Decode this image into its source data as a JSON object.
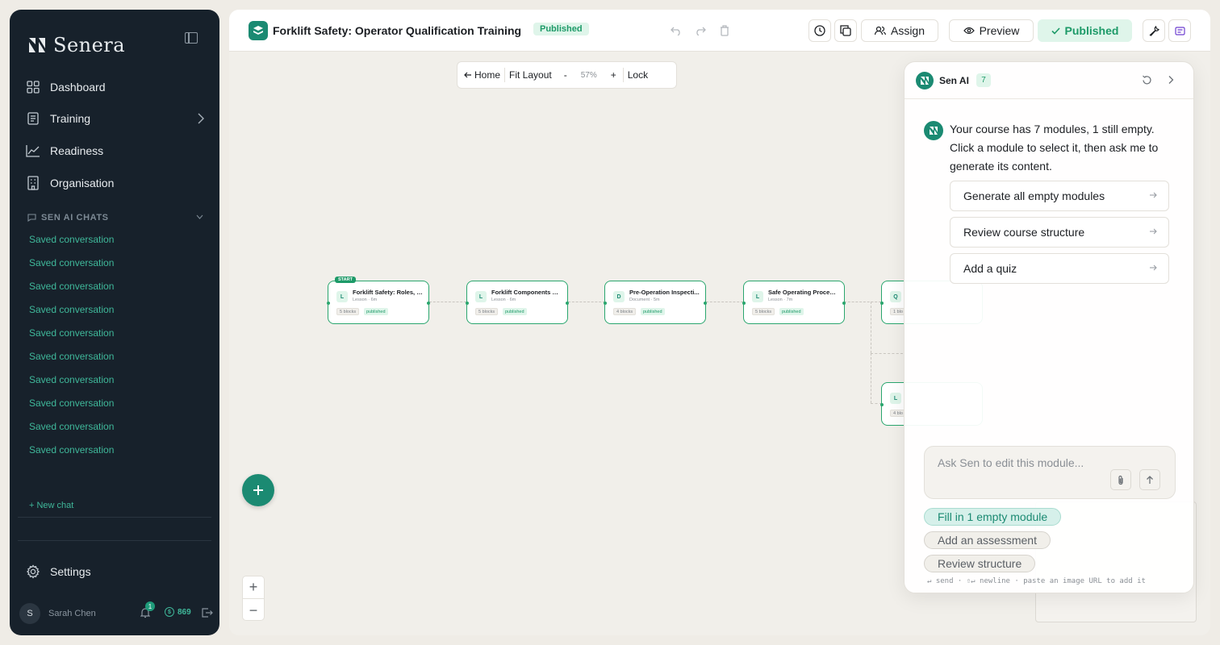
{
  "brand": {
    "name": "Senera"
  },
  "nav": [
    {
      "label": "Dashboard",
      "icon": "dashboard-icon"
    },
    {
      "label": "Training",
      "icon": "training-icon"
    },
    {
      "label": "Readiness",
      "icon": "readiness-icon"
    },
    {
      "label": "Organisation",
      "icon": "organisation-icon"
    }
  ],
  "chats": {
    "header": "SEN AI CHATS",
    "items": [
      "Saved conversation",
      "Saved conversation",
      "Saved conversation",
      "Saved conversation",
      "Saved conversation",
      "Saved conversation",
      "Saved conversation",
      "Saved conversation",
      "Saved conversation",
      "Saved conversation"
    ],
    "new_chat": "+ New chat"
  },
  "settings_label": "Settings",
  "user": {
    "initial": "S",
    "name": "Sarah Chen",
    "notifications": "1",
    "credits": "869"
  },
  "course": {
    "title": "Forklift Safety: Operator Qualification Training",
    "status": "Published"
  },
  "toolbar": {
    "assign": "Assign",
    "preview": "Preview",
    "published": "Published"
  },
  "canvas": {
    "home": "Home",
    "fit": "Fit Layout",
    "minus": "-",
    "zoom": "57%",
    "plus": "+",
    "lock": "Lock"
  },
  "nodes": [
    {
      "type": "L",
      "title": "Forklift Safety: Roles, Ri...",
      "sub": "Lesson · 6m",
      "blocks": "5 blocks",
      "status": "published",
      "start": "START"
    },
    {
      "type": "L",
      "title": "Forklift Components & ...",
      "sub": "Lesson · 6m",
      "blocks": "5 blocks",
      "status": "published"
    },
    {
      "type": "D",
      "title": "Pre-Operation Inspecti...",
      "sub": "Document · 5m",
      "blocks": "4 blocks",
      "status": "published"
    },
    {
      "type": "L",
      "title": "Safe Operating Procedu...",
      "sub": "Lesson · 7m",
      "blocks": "5 blocks",
      "status": "published"
    },
    {
      "type": "Q",
      "title": "",
      "sub": "",
      "blocks": "1 blo",
      "status": ""
    },
    {
      "type": "L",
      "title": "",
      "sub": "",
      "blocks": "4 blo",
      "status": ""
    }
  ],
  "ai": {
    "name": "Sen AI",
    "count": "7",
    "message": "Your course has 7 modules, 1 still empty. Click a module to select it, then ask me to generate its content.",
    "actions": [
      "Generate all empty modules",
      "Review course structure",
      "Add a quiz"
    ],
    "input_placeholder": "Ask Sen to edit this module...",
    "suggestions": [
      "Fill in 1 empty module",
      "Add an assessment",
      "Review structure"
    ],
    "hint": "↵ send · ⇧↵ newline · paste an image URL to add it"
  },
  "colors": {
    "accent": "#1b8a72",
    "sidebar": "#17212b",
    "published": "#1d9a68"
  }
}
